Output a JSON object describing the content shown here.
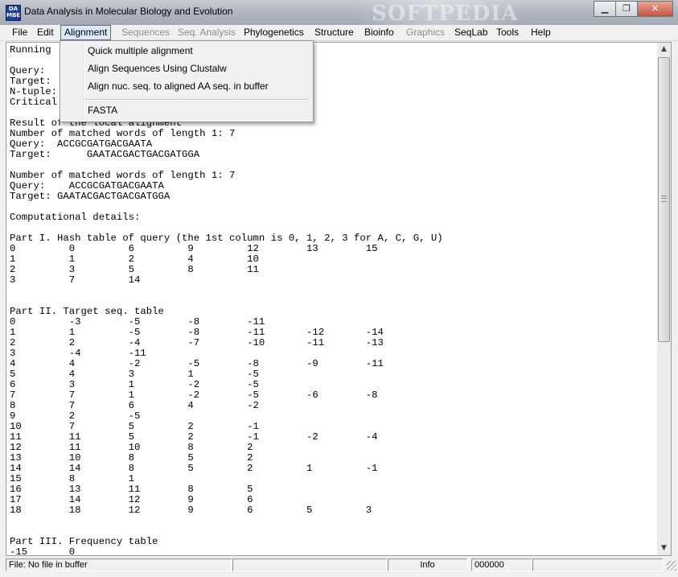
{
  "window": {
    "title": "Data Analysis in Molecular Biology and Evolution",
    "icon_text": [
      "DA",
      "MBE"
    ],
    "watermark": "SOFTPEDIA",
    "buttons": {
      "minimize": "▁",
      "maximize": "❐",
      "close": "✕"
    }
  },
  "menubar": {
    "items": [
      {
        "label": "File",
        "enabled": true
      },
      {
        "label": "Edit",
        "enabled": true
      },
      {
        "label": "Alignment",
        "enabled": true,
        "active": true
      },
      {
        "label": "Sequences",
        "enabled": false
      },
      {
        "label": "Seq. Analysis",
        "enabled": false
      },
      {
        "label": "Phylogenetics",
        "enabled": true
      },
      {
        "label": "Structure",
        "enabled": true
      },
      {
        "label": "Bioinfo",
        "enabled": true
      },
      {
        "label": "Graphics",
        "enabled": false
      },
      {
        "label": "SeqLab",
        "enabled": true
      },
      {
        "label": "Tools",
        "enabled": true
      },
      {
        "label": "Help",
        "enabled": true
      }
    ]
  },
  "dropdown": {
    "items": [
      "Quick multiple alignment",
      "Align Sequences Using Clustalw",
      "Align nuc. seq. to aligned AA seq. in buffer",
      "FASTA"
    ]
  },
  "content": {
    "text": "Running                                   quences\n\nQuery:\nTarget:\nN-tuple:\nCritical\n\nResult of the local alignment\nNumber of matched words of length 1: 7\nQuery:  ACCGCGATGACGAATA\nTarget:      GAATACGACTGACGATGGA\n\nNumber of matched words of length 1: 7\nQuery:    ACCGCGATGACGAATA\nTarget: GAATACGACTGACGATGGA\n\nComputational details:\n\nPart I. Hash table of query (the 1st column is 0, 1, 2, 3 for A, C, G, U)\n0         0         6         9         12        13        15\n1         1         2         4         10\n2         3         5         8         11\n3         7         14\n\n\nPart II. Target seq. table\n0         -3        -5        -8        -11\n1         1         -5        -8        -11       -12       -14\n2         2         -4        -7        -10       -11       -13\n3         -4        -11\n4         4         -2        -5        -8        -9        -11\n5         4         3         1         -5\n6         3         1         -2        -5\n7         7         1         -2        -5        -6        -8\n8         7         6         4         -2\n9         2         -5\n10        7         5         2         -1\n11        11        5         2         -1        -2        -4\n12        11        10        8         2\n13        10        8         5         2\n14        14        8         5         2         1         -1\n15        8         1\n16        13        11        8         5\n17        14        12        9         6\n18        18        12        9         6         5         3\n\n\nPart III. Frequency table\n-15       0"
  },
  "statusbar": {
    "file": "File: No file in buffer",
    "panel2": "",
    "panel3": "",
    "info": "Info",
    "counter": "000000"
  }
}
